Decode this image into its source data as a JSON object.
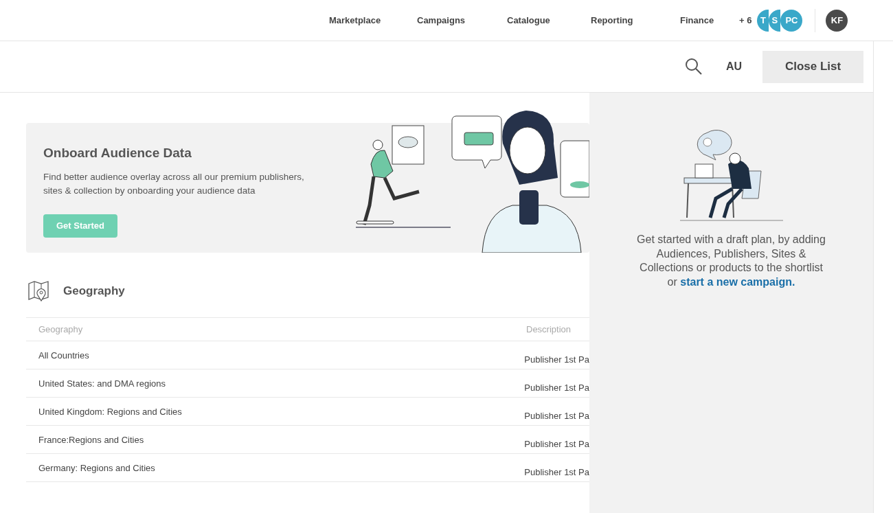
{
  "nav": {
    "items": [
      {
        "label": "Marketplace"
      },
      {
        "label": "Campaigns"
      },
      {
        "label": "Catalogue"
      },
      {
        "label": "Reporting"
      },
      {
        "label": "Finance"
      }
    ],
    "more_count": "+ 6",
    "avatars": [
      {
        "initials": "T",
        "color": "#3aa8c9"
      },
      {
        "initials": "S",
        "color": "#3aa8c9"
      },
      {
        "initials": "PC",
        "color": "#3aa8c9"
      }
    ],
    "user": {
      "initials": "KF"
    }
  },
  "toolbar": {
    "region": "AU",
    "close_button": "Close List"
  },
  "banner": {
    "title": "Onboard Audience Data",
    "text": "Find better audience overlay across all our premium publishers, sites & collection by onboarding your audience data",
    "button": "Get Started"
  },
  "geography": {
    "title": "Geography",
    "columns": [
      "Geography",
      "Description"
    ],
    "rows": [
      {
        "name": "All Countries",
        "description": "Publisher 1st Pa"
      },
      {
        "name": "United States: and DMA regions",
        "description": "Publisher 1st Pa"
      },
      {
        "name": "United Kingdom: Regions and Cities",
        "description": "Publisher 1st Pa"
      },
      {
        "name": "France:Regions and Cities",
        "description": "Publisher 1st Pa"
      },
      {
        "name": "Germany: Regions and Cities",
        "description": "Publisher 1st Pa"
      }
    ]
  },
  "shortlist": {
    "message": "Get started with a draft plan, by adding Audiences, Publishers, Sites & Collections or products to the shortlist or",
    "link": "start a new campaign."
  }
}
